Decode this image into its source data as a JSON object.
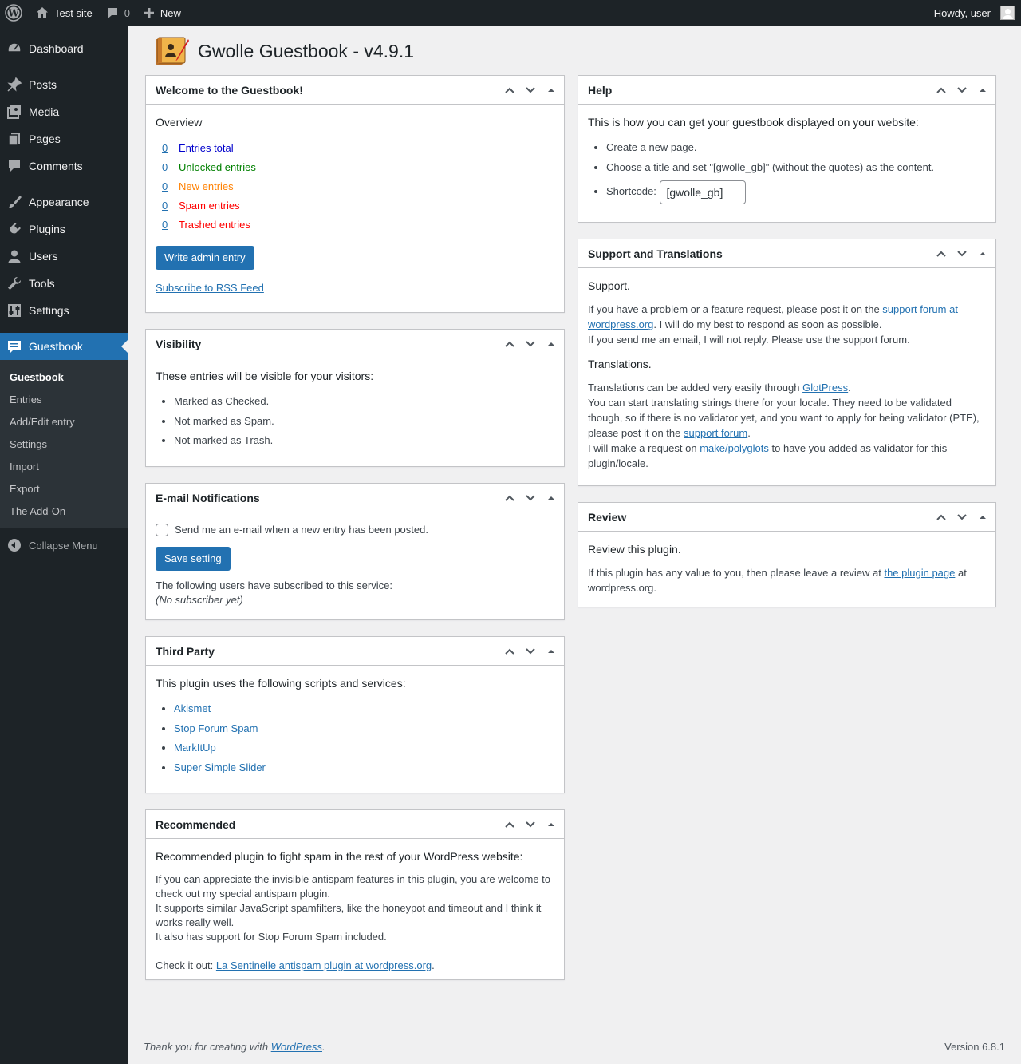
{
  "adminbar": {
    "site_name": "Test site",
    "comments_count": "0",
    "new_label": "New",
    "howdy": "Howdy, user"
  },
  "sidebar": {
    "items": [
      {
        "label": "Dashboard",
        "icon": "dashboard-icon"
      },
      {
        "label": "Posts",
        "icon": "pin-icon"
      },
      {
        "label": "Media",
        "icon": "media-icon"
      },
      {
        "label": "Pages",
        "icon": "pages-icon"
      },
      {
        "label": "Comments",
        "icon": "comments-icon"
      },
      {
        "label": "Appearance",
        "icon": "brush-icon"
      },
      {
        "label": "Plugins",
        "icon": "plugin-icon"
      },
      {
        "label": "Users",
        "icon": "user-icon"
      },
      {
        "label": "Tools",
        "icon": "wrench-icon"
      },
      {
        "label": "Settings",
        "icon": "settings-icon"
      },
      {
        "label": "Guestbook",
        "icon": "guestbook-icon"
      }
    ],
    "submenu": [
      "Guestbook",
      "Entries",
      "Add/Edit entry",
      "Settings",
      "Import",
      "Export",
      "The Add-On"
    ],
    "collapse_label": "Collapse Menu",
    "accent": "#2271b1"
  },
  "page": {
    "title": "Gwolle Guestbook - v4.9.1"
  },
  "welcome": {
    "title": "Welcome to the Guestbook!",
    "overview": "Overview",
    "rows": [
      {
        "count": "0",
        "label": "Entries total",
        "color": "#0000cc"
      },
      {
        "count": "0",
        "label": "Unlocked entries",
        "color": "#008000"
      },
      {
        "count": "0",
        "label": "New entries",
        "color": "#ff8000"
      },
      {
        "count": "0",
        "label": "Spam entries",
        "color": "#ff0000"
      },
      {
        "count": "0",
        "label": "Trashed entries",
        "color": "#ff0000"
      }
    ],
    "write_button": "Write admin entry",
    "rss_link": "Subscribe to RSS Feed"
  },
  "visibility": {
    "title": "Visibility",
    "lead": "These entries will be visible for your visitors:",
    "items": [
      "Marked as Checked.",
      "Not marked as Spam.",
      "Not marked as Trash."
    ]
  },
  "email": {
    "title": "E-mail Notifications",
    "checkbox_label": "Send me an e-mail when a new entry has been posted.",
    "save_button": "Save setting",
    "subscribed_text": "The following users have subscribed to this service:",
    "no_subscriber": "(No subscriber yet)"
  },
  "third_party": {
    "title": "Third Party",
    "lead": "This plugin uses the following scripts and services:",
    "items": [
      "Akismet",
      "Stop Forum Spam",
      "MarkItUp",
      "Super Simple Slider"
    ]
  },
  "recommended": {
    "title": "Recommended",
    "lead": "Recommended plugin to fight spam in the rest of your WordPress website:",
    "line1": "If you can appreciate the invisible antispam features in this plugin, you are welcome to check out my special antispam plugin.",
    "line2": "It supports similar JavaScript spamfilters, like the honeypot and timeout and I think it works really well.",
    "line3": "It also has support for Stop Forum Spam included.",
    "check_prefix": "Check it out: ",
    "check_link": "La Sentinelle antispam plugin at wordpress.org",
    "check_suffix": "."
  },
  "help": {
    "title": "Help",
    "lead": "This is how you can get your guestbook displayed on your website:",
    "item1": "Create a new page.",
    "item2": "Choose a title and set \"[gwolle_gb]\" (without the quotes) as the content.",
    "shortcode_label": "Shortcode:",
    "shortcode_value": "[gwolle_gb]"
  },
  "support": {
    "title": "Support and Translations",
    "support_heading": "Support.",
    "s1_prefix": "If you have a problem or a feature request, please post it on the ",
    "s1_link": "support forum at wordpress.org",
    "s1_suffix": ". I will do my best to respond as soon as possible.",
    "s2": "If you send me an email, I will not reply. Please use the support forum.",
    "translations_heading": "Translations.",
    "t1_prefix": "Translations can be added very easily through ",
    "t1_link": "GlotPress",
    "t1_suffix": ".",
    "t2_prefix": "You can start translating strings there for your locale. They need to be validated though, so if there is no validator yet, and you want to apply for being validator (PTE), please post it on the ",
    "t2_link": "support forum",
    "t2_suffix": ".",
    "t3_prefix": "I will make a request on ",
    "t3_link": "make/polyglots",
    "t3_suffix": " to have you added as validator for this plugin/locale."
  },
  "review": {
    "title": "Review",
    "lead": "Review this plugin.",
    "r_prefix": "If this plugin has any value to you, then please leave a review at ",
    "r_link": "the plugin page",
    "r_suffix": " at wordpress.org."
  },
  "footer": {
    "thanks_prefix": "Thank you for creating with ",
    "thanks_link": "WordPress",
    "thanks_suffix": ".",
    "version": "Version 6.8.1"
  }
}
